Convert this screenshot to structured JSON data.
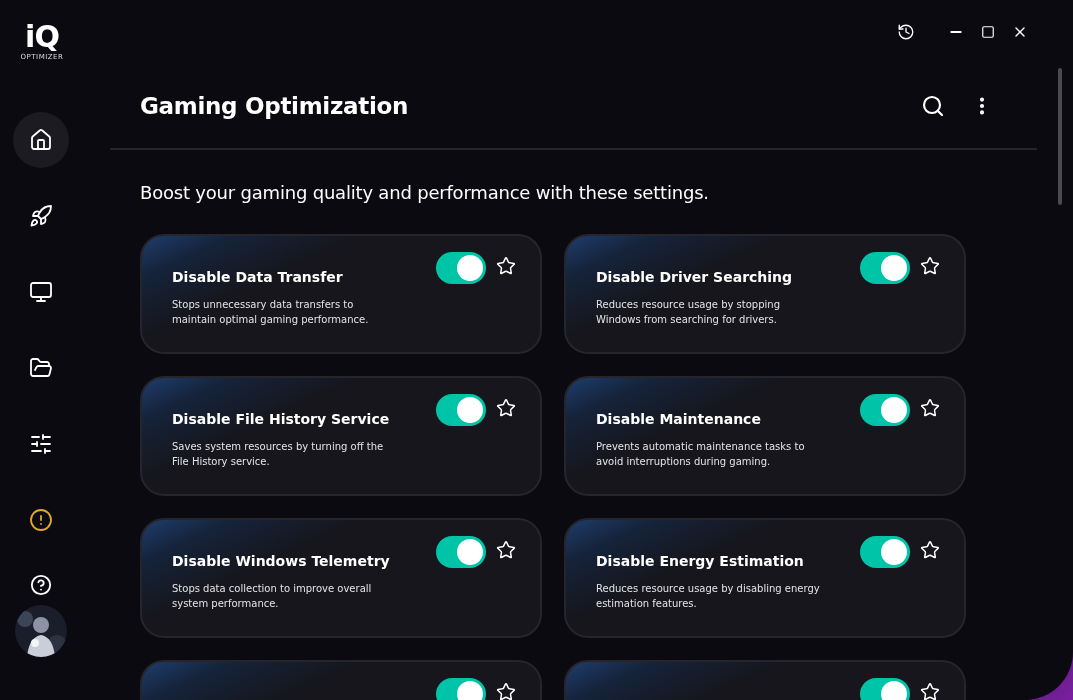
{
  "logo": {
    "mark": "iQ",
    "wordmark": "OPTIMIZER"
  },
  "sidebar": {
    "items": [
      {
        "selected": true
      },
      {
        "selected": false
      },
      {
        "selected": false
      },
      {
        "selected": false
      },
      {
        "selected": false
      },
      {
        "selected": false
      }
    ]
  },
  "header": {
    "title": "Gaming Optimization",
    "subtitle": "Boost your gaming quality and performance with these settings."
  },
  "settings": [
    {
      "title": "Disable Data Transfer",
      "description": "Stops unnecessary data transfers to maintain optimal gaming performance.",
      "on": true,
      "favorite": false
    },
    {
      "title": "Disable Driver Searching",
      "description": "Reduces resource usage by stopping Windows from searching for drivers.",
      "on": true,
      "favorite": false
    },
    {
      "title": "Disable File History Service",
      "description": "Saves system resources by turning off the File History service.",
      "on": true,
      "favorite": false
    },
    {
      "title": "Disable Maintenance",
      "description": "Prevents automatic maintenance tasks to avoid interruptions during gaming.",
      "on": true,
      "favorite": false
    },
    {
      "title": "Disable Windows Telemetry",
      "description": "Stops data collection to improve overall system performance.",
      "on": true,
      "favorite": false
    },
    {
      "title": "Disable Energy Estimation",
      "description": "Reduces resource usage by disabling energy estimation features.",
      "on": true,
      "favorite": false
    },
    {
      "on": true,
      "favorite": false
    },
    {
      "on": true,
      "favorite": false
    }
  ]
}
